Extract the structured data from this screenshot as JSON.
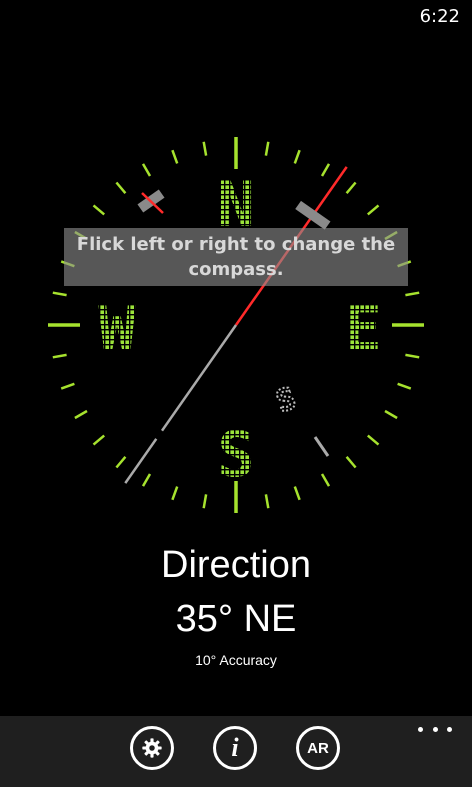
{
  "status": {
    "time": "6:22"
  },
  "compass": {
    "cardinals": {
      "n": "N",
      "e": "E",
      "s": "S",
      "w": "W"
    },
    "rotated_letter": "S",
    "tick_color": "#A6E22E",
    "cardinal_color": "#9BE33A",
    "needle_color": "#FF2A2A",
    "heading_degrees": 35
  },
  "hint": {
    "text": "Flick left or right to change the compass."
  },
  "reading": {
    "label": "Direction",
    "value": "35° NE",
    "accuracy": "10°  Accuracy"
  },
  "appbar": {
    "settings_icon": "gear-icon",
    "info_icon": "info-icon",
    "info_glyph": "i",
    "ar_label": "AR",
    "more_icon": "ellipsis-icon"
  }
}
